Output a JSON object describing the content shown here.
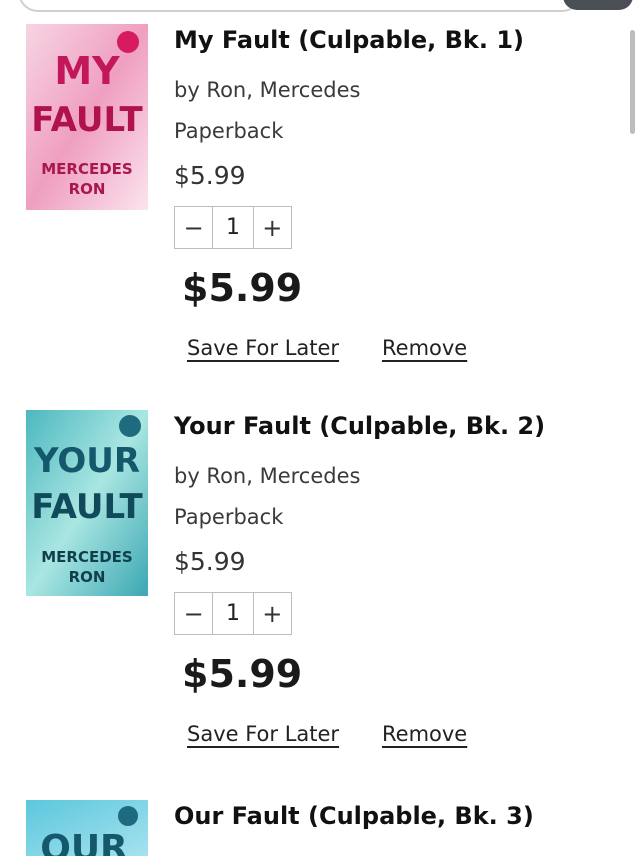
{
  "cart": {
    "items": [
      {
        "title": "My Fault (Culpable, Bk. 1)",
        "author": "by Ron, Mercedes",
        "format": "Paperback",
        "unit_price": "$5.99",
        "quantity": "1",
        "line_total": "$5.99",
        "save_label": "Save For Later",
        "remove_label": "Remove",
        "cover": {
          "line1": "MY",
          "line2": "FAULT",
          "author1": "MERCEDES",
          "author2": "RON",
          "bg": "#f3c6d8",
          "text": "#c2185b"
        }
      },
      {
        "title": "Your Fault (Culpable, Bk. 2)",
        "author": "by Ron, Mercedes",
        "format": "Paperback",
        "unit_price": "$5.99",
        "quantity": "1",
        "line_total": "$5.99",
        "save_label": "Save For Later",
        "remove_label": "Remove",
        "cover": {
          "line1": "YOUR",
          "line2": "FAULT",
          "author1": "MERCEDES",
          "author2": "RON",
          "bg": "#7fd3d6",
          "text": "#145a66"
        }
      },
      {
        "title": "Our Fault (Culpable, Bk. 3)",
        "cover": {
          "line1": "OUR",
          "bg": "#7fd3e6",
          "text": "#145a66"
        }
      }
    ]
  },
  "icons": {
    "minus": "minus-icon",
    "plus": "plus-icon"
  }
}
